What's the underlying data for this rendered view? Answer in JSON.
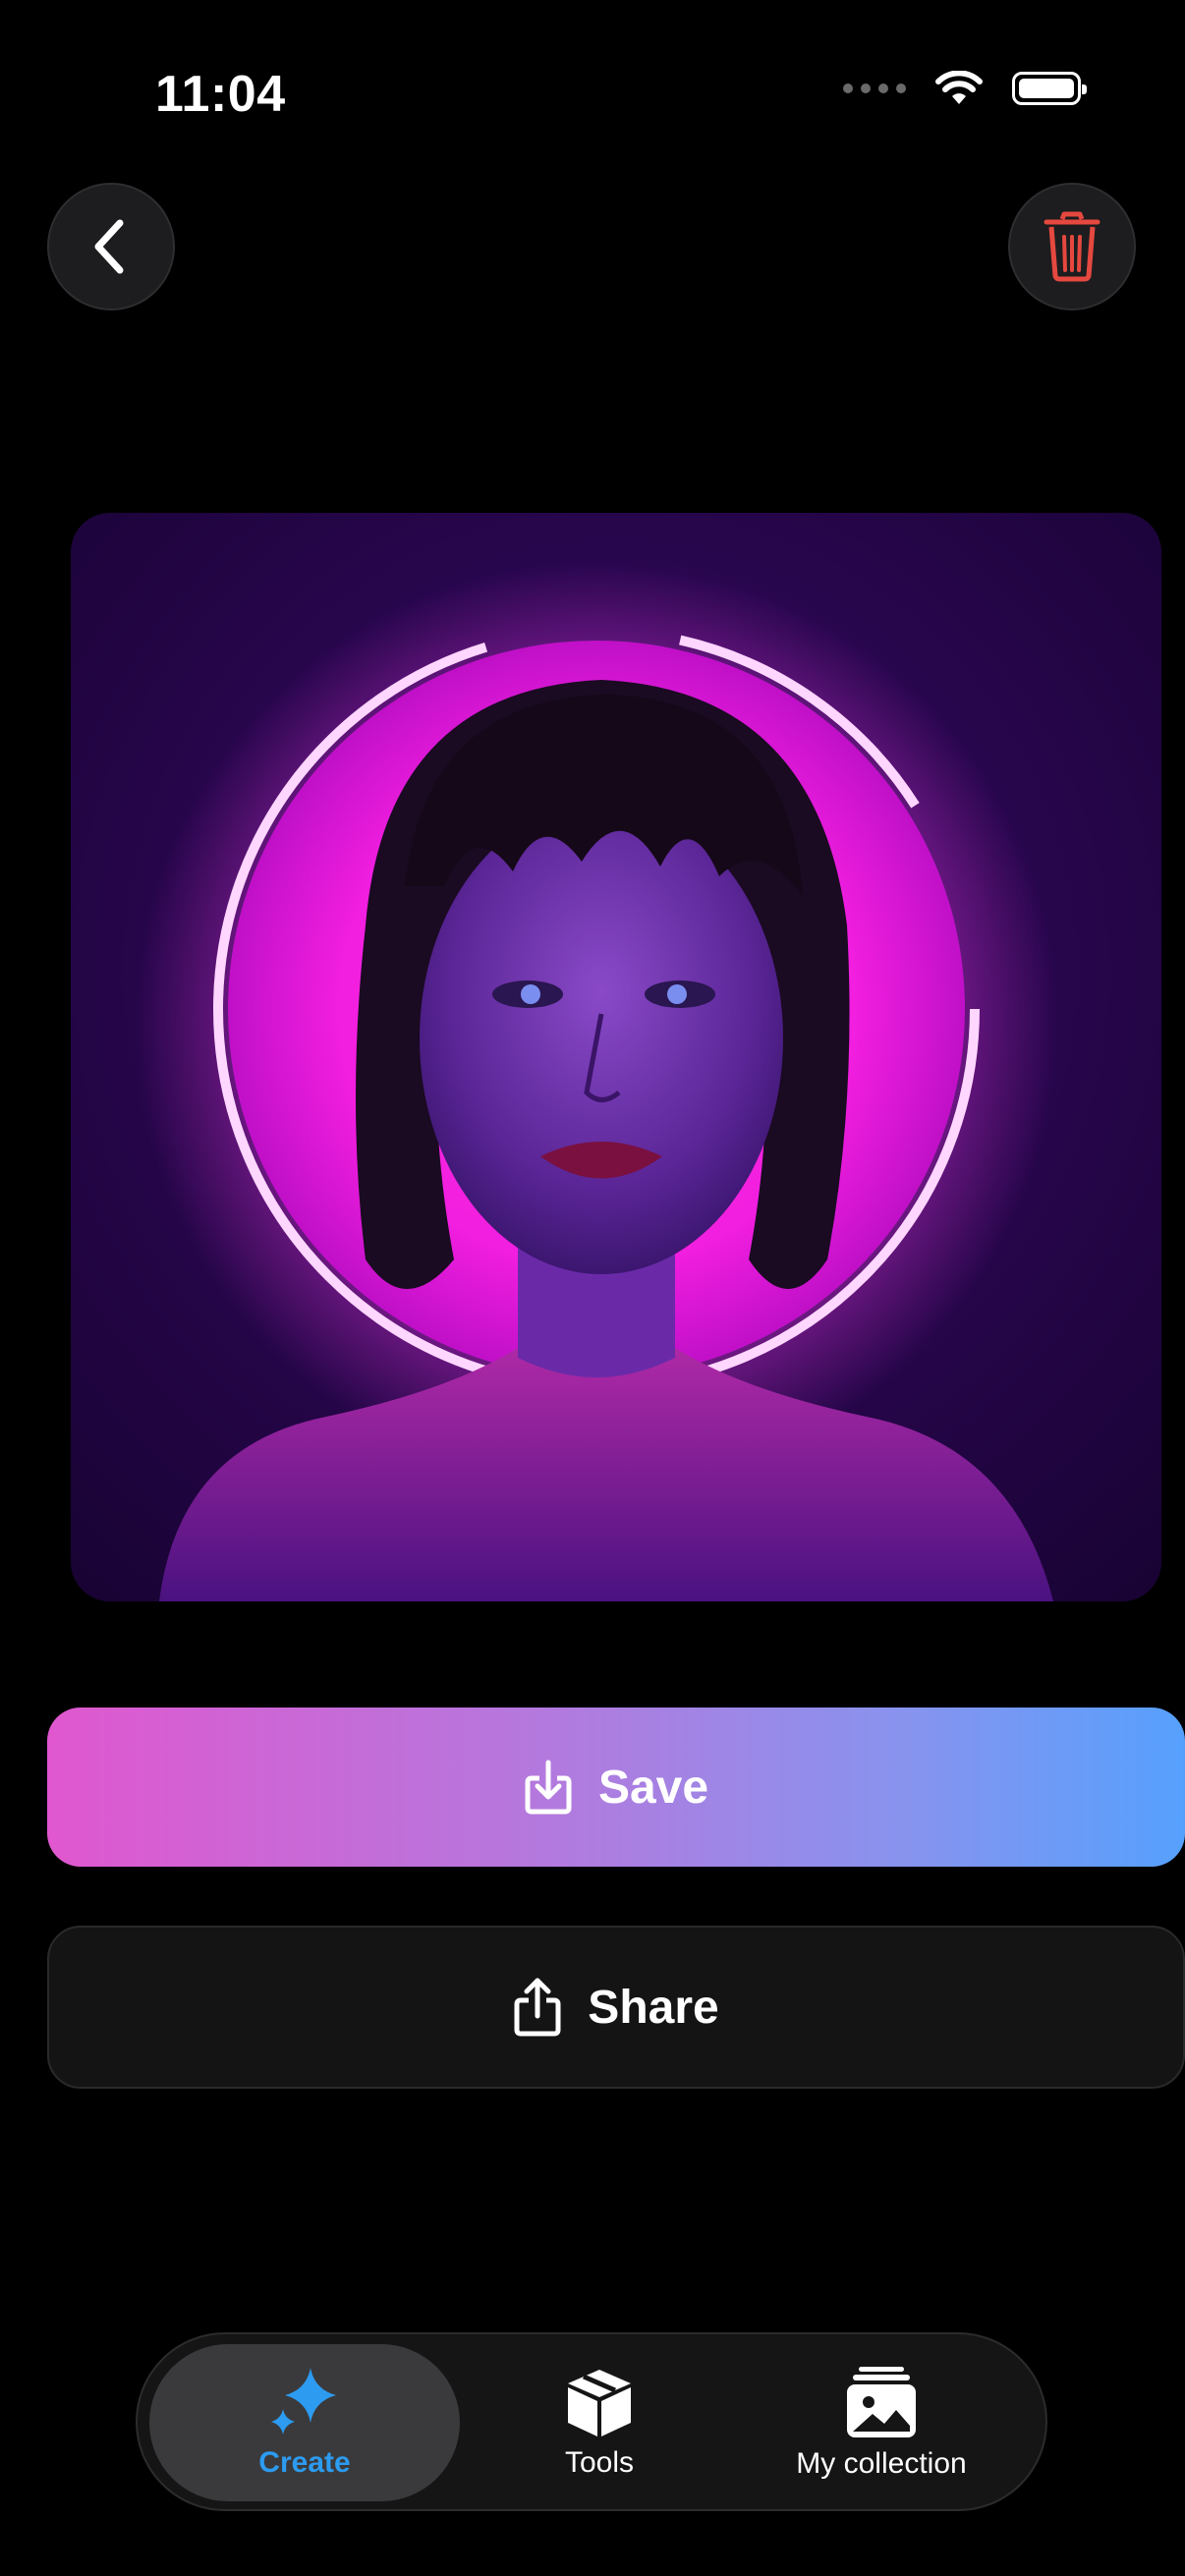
{
  "status_bar": {
    "time": "11:04"
  },
  "header": {
    "back_icon": "chevron-left-icon",
    "delete_icon": "trash-icon"
  },
  "artwork": {
    "description_icon": "generated-image"
  },
  "actions": {
    "save_label": "Save",
    "share_label": "Share"
  },
  "tab_bar": {
    "tabs": [
      {
        "label": "Create",
        "icon": "sparkle-icon",
        "active": true
      },
      {
        "label": "Tools",
        "icon": "box-icon",
        "active": false
      },
      {
        "label": "My collection",
        "icon": "photo-stack-icon",
        "active": false
      }
    ]
  },
  "colors": {
    "accent_blue": "#2c9bf0",
    "delete_red": "#e5483f",
    "gradient_start": "#e057cf",
    "gradient_end": "#56a0fd"
  }
}
